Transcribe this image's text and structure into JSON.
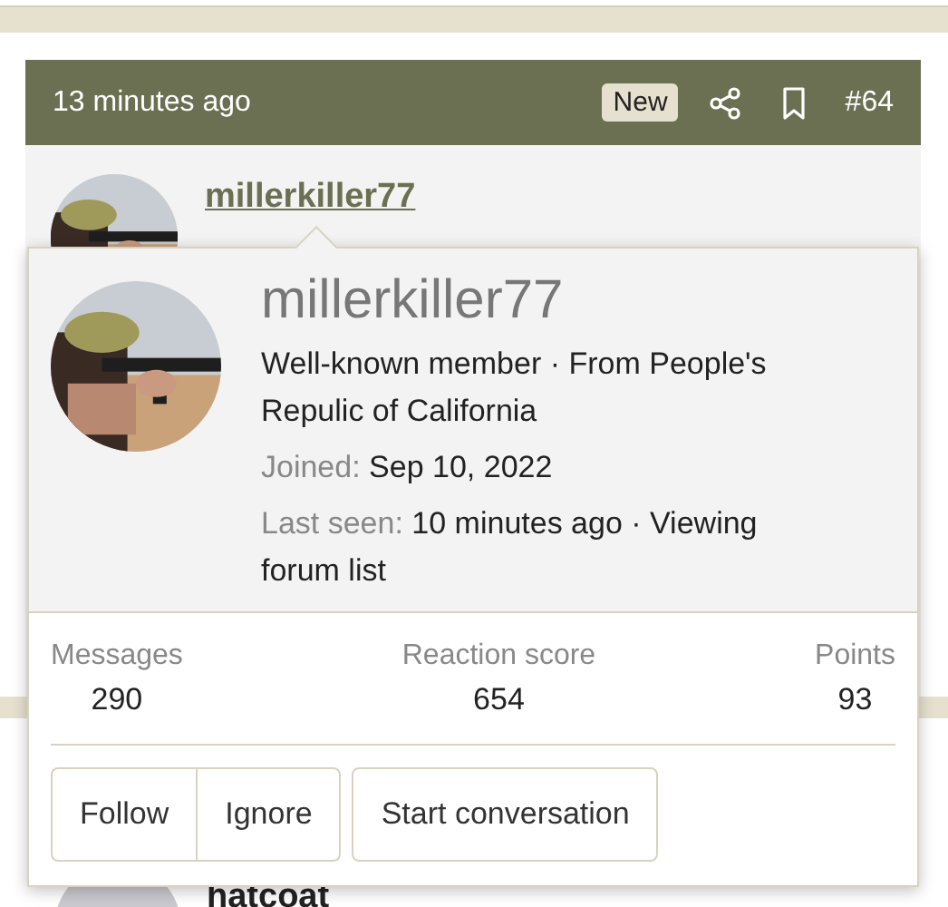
{
  "post": {
    "time": "13 minutes ago",
    "badge": "New",
    "number": "#64",
    "author": "millerkiller77"
  },
  "popup": {
    "username": "millerkiller77",
    "title_line": "Well-known member · From People's Repulic of California",
    "joined_label": "Joined:",
    "joined": "Sep 10, 2022",
    "last_seen_label": "Last seen:",
    "last_seen": "10 minutes ago · Viewing forum list",
    "stats": [
      {
        "label": "Messages",
        "value": "290"
      },
      {
        "label": "Reaction score",
        "value": "654"
      },
      {
        "label": "Points",
        "value": "93"
      }
    ],
    "button_group": [
      "Follow",
      "Ignore"
    ],
    "buttons": [
      "Start conversation"
    ]
  },
  "next_post": {
    "author": "hatcoat"
  }
}
